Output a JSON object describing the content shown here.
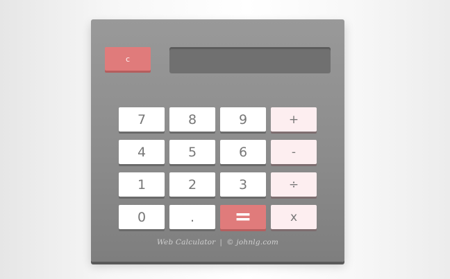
{
  "calculator": {
    "clear_label": "c",
    "display_value": "",
    "keys": [
      {
        "label": "7",
        "type": "digit",
        "name": "key-7"
      },
      {
        "label": "8",
        "type": "digit",
        "name": "key-8"
      },
      {
        "label": "9",
        "type": "digit",
        "name": "key-9"
      },
      {
        "label": "+",
        "type": "op",
        "name": "key-add"
      },
      {
        "label": "4",
        "type": "digit",
        "name": "key-4"
      },
      {
        "label": "5",
        "type": "digit",
        "name": "key-5"
      },
      {
        "label": "6",
        "type": "digit",
        "name": "key-6"
      },
      {
        "label": "-",
        "type": "op",
        "name": "key-subtract"
      },
      {
        "label": "1",
        "type": "digit",
        "name": "key-1"
      },
      {
        "label": "2",
        "type": "digit",
        "name": "key-2"
      },
      {
        "label": "3",
        "type": "digit",
        "name": "key-3"
      },
      {
        "label": "÷",
        "type": "op",
        "name": "key-divide"
      },
      {
        "label": "0",
        "type": "digit",
        "name": "key-0"
      },
      {
        "label": ".",
        "type": "digit",
        "name": "key-decimal"
      },
      {
        "label": "=",
        "type": "eq",
        "name": "key-equals"
      },
      {
        "label": "x",
        "type": "op",
        "name": "key-multiply"
      }
    ],
    "footer": {
      "title": "Web Calculator",
      "separator": "|",
      "credit": "© johnlg.com"
    }
  },
  "colors": {
    "accent": "#e07b7b",
    "operator_key": "#fdeef0",
    "digit_key": "#ffffff",
    "body": "#8c8c8c",
    "display": "#707070"
  }
}
